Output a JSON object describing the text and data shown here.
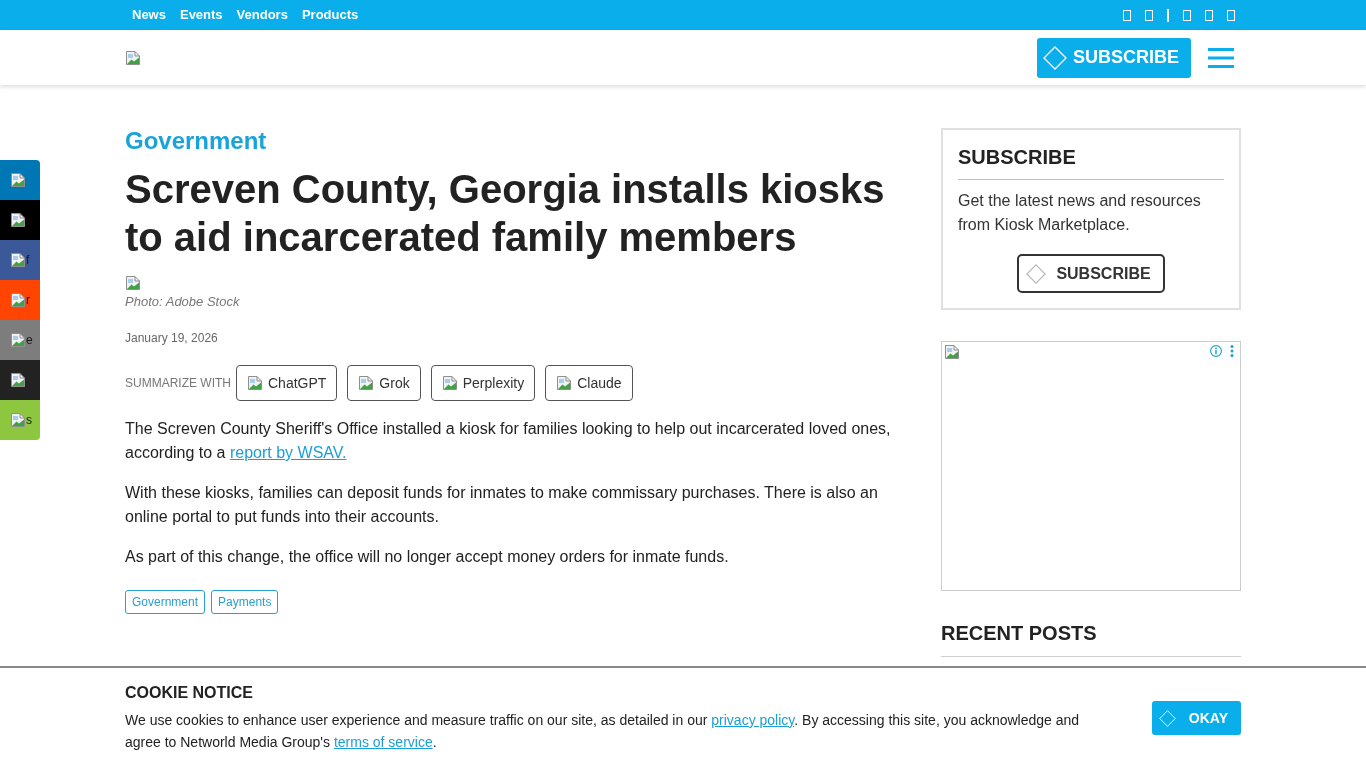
{
  "top_bar": {
    "links": [
      {
        "label": "News"
      },
      {
        "label": "Events"
      },
      {
        "label": "Vendors"
      },
      {
        "label": "Products"
      }
    ]
  },
  "header": {
    "subscribe_button": {
      "label": "SUBSCRIBE"
    }
  },
  "social_bar": {
    "items": [
      {
        "color": "#0077b5"
      },
      {
        "color": "#000000"
      },
      {
        "color": "#3b5998",
        "alt_text": "f"
      },
      {
        "color": "#ff4500",
        "alt_text": "r"
      },
      {
        "color": "#7d7d7d",
        "alt_text": "e"
      },
      {
        "color": "#222222"
      },
      {
        "color": "#8dc63f",
        "alt_text": "s"
      }
    ]
  },
  "article": {
    "category": "Government",
    "title": "Screven County, Georgia installs kiosks to aid incarcerated family members",
    "photo_credit": "Photo: Adobe Stock",
    "date": "January 19, 2026",
    "summarize": {
      "label": "SUMMARIZE WITH",
      "buttons": [
        {
          "label": "ChatGPT"
        },
        {
          "label": "Grok"
        },
        {
          "label": "Perplexity"
        },
        {
          "label": "Claude"
        }
      ]
    },
    "paragraphs": [
      [
        {
          "kind": "text",
          "text": "The Screven County Sheriff's Office installed a kiosk for families looking to help out incarcerated loved ones, according to a "
        },
        {
          "kind": "link",
          "text": "report by WSAV."
        }
      ],
      [
        {
          "kind": "text",
          "text": "With these kiosks, families can deposit funds for inmates to make commissary purchases. There is also an online portal to put funds into their accounts."
        }
      ],
      [
        {
          "kind": "text",
          "text": "As part of this change, the office will no longer accept money orders for inmate funds."
        }
      ]
    ],
    "tags": [
      {
        "label": "Government"
      },
      {
        "label": "Payments"
      }
    ]
  },
  "sidebar": {
    "subscribe": {
      "title": "SUBSCRIBE",
      "text": "Get the latest news and resources from Kiosk Marketplace.",
      "button": "SUBSCRIBE"
    },
    "recent_posts": {
      "title": "RECENT POSTS"
    }
  },
  "cookie_notice": {
    "title": "COOKIE NOTICE",
    "text": [
      {
        "kind": "text",
        "text": "We use cookies to enhance user experience and measure traffic on our site, as detailed in our "
      },
      {
        "kind": "link",
        "text": "privacy policy"
      },
      {
        "kind": "text",
        "text": ". By accessing this site, you acknowledge and agree to Networld Media Group's "
      },
      {
        "kind": "link",
        "text": "terms of service"
      },
      {
        "kind": "text",
        "text": "."
      }
    ],
    "button": "OKAY"
  }
}
